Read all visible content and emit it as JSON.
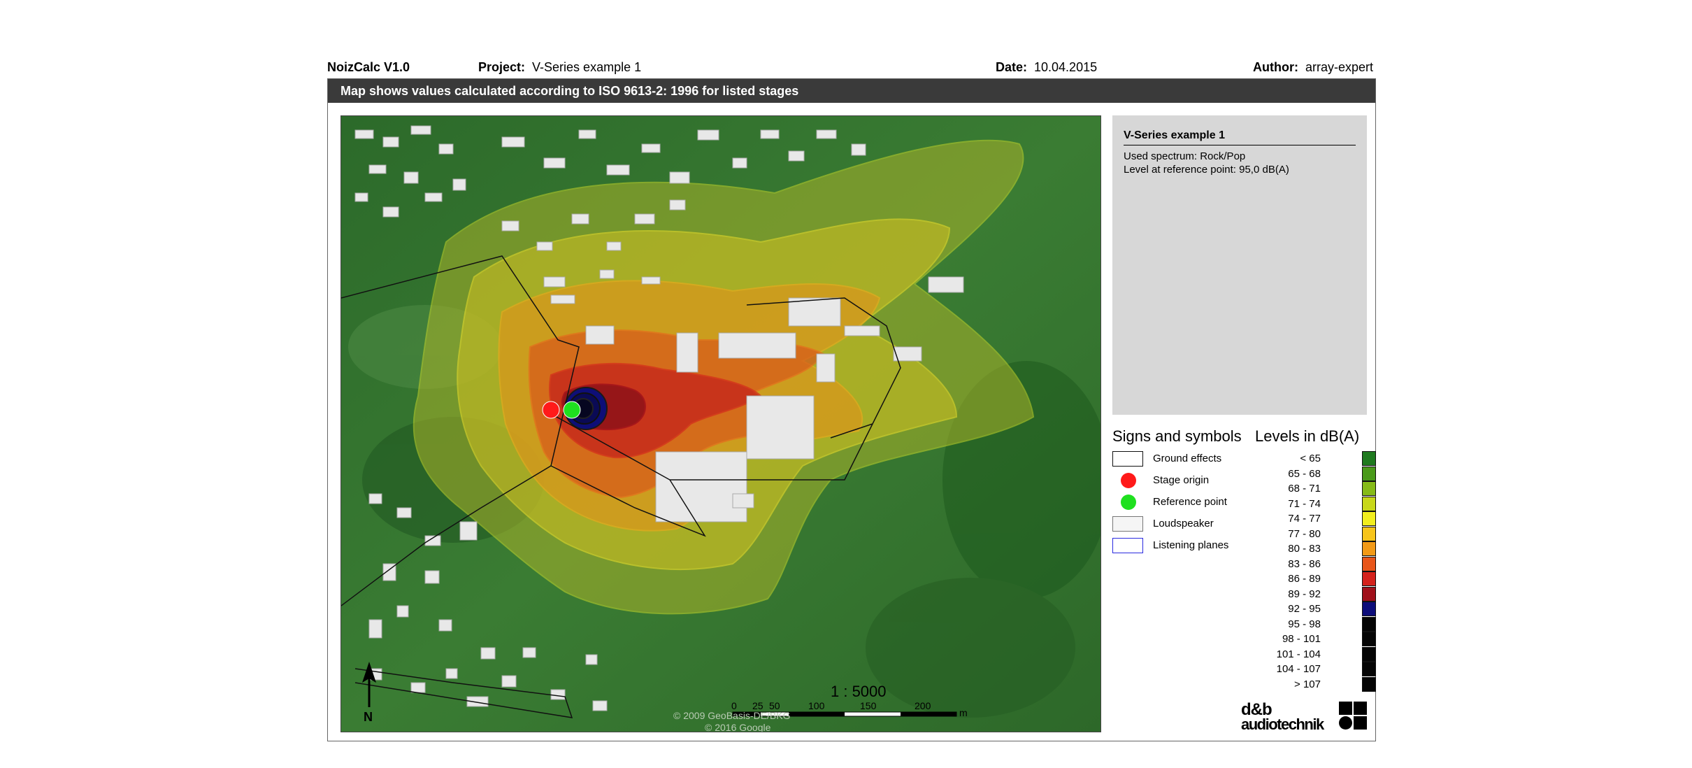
{
  "header": {
    "app": "NoizCalc V1.0",
    "project_label": "Project:",
    "project": "V-Series example 1",
    "date_label": "Date:",
    "date": "10.04.2015",
    "author_label": "Author:",
    "author": "array-expert"
  },
  "banner": "Map shows values calculated according to ISO 9613-2: 1996 for listed stages",
  "info": {
    "title": "V-Series example 1",
    "spectrum_label": "Used spectrum:",
    "spectrum": "Rock/Pop",
    "reference_label": "Level at reference point:",
    "reference": "95,0 dB(A)"
  },
  "symbols": {
    "title": "Signs and symbols",
    "items": [
      {
        "label": "Ground effects",
        "kind": "outline-black"
      },
      {
        "label": "Stage origin",
        "kind": "dot",
        "color": "#ff1a1a"
      },
      {
        "label": "Reference point",
        "kind": "dot",
        "color": "#1fe01f"
      },
      {
        "label": "Loudspeaker",
        "kind": "box-grey"
      },
      {
        "label": "Listening planes",
        "kind": "outline-blue"
      }
    ]
  },
  "levels": {
    "title": "Levels in dB(A)",
    "items": [
      {
        "label": "<  65",
        "color": "#1f7a1f"
      },
      {
        "label": "65 -  68",
        "color": "#4a9a1a"
      },
      {
        "label": "68 -  71",
        "color": "#86bb18"
      },
      {
        "label": "71 -  74",
        "color": "#c8d81a"
      },
      {
        "label": "74 -  77",
        "color": "#f2ee1e"
      },
      {
        "label": "77 -  80",
        "color": "#f7c51b"
      },
      {
        "label": "80 -  83",
        "color": "#f29a17"
      },
      {
        "label": "83 -  86",
        "color": "#e8561a"
      },
      {
        "label": "86 -  89",
        "color": "#d4221c"
      },
      {
        "label": "89 -  92",
        "color": "#a0101a"
      },
      {
        "label": "92 -  95",
        "color": "#0d0d7a"
      },
      {
        "label": "95 -  98",
        "color": "#050505"
      },
      {
        "label": "98 - 101",
        "color": "#050505"
      },
      {
        "label": "101 - 104",
        "color": "#050505"
      },
      {
        "label": "104 - 107",
        "color": "#050505"
      },
      {
        "label": "> 107",
        "color": "#050505"
      }
    ]
  },
  "map": {
    "scale": "1 : 5000",
    "scale_ticks": [
      "0",
      "25",
      "50",
      "100",
      "150",
      "200"
    ],
    "scale_unit": "m",
    "north": "N",
    "copyright_1": "© 2009 GeoBasis-DE/BKG",
    "copyright_2": "© 2016 Google"
  },
  "logo": {
    "line1": "d&b",
    "line2": "audiotechnik"
  }
}
